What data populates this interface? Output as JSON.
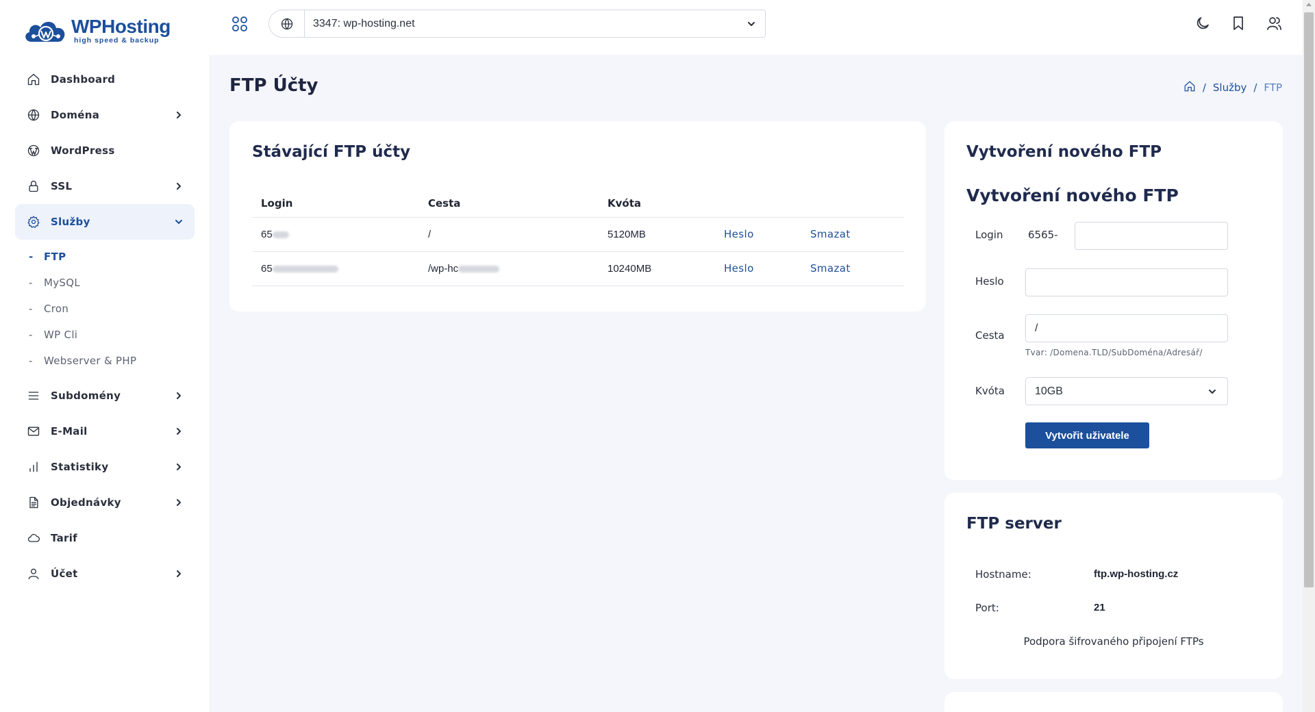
{
  "brand": {
    "name": "WPHosting",
    "tagline": "high speed & backup"
  },
  "header": {
    "domain_value": "3347: wp-hosting.net"
  },
  "sidebar": {
    "items": [
      {
        "label": "Dashboard",
        "icon": "home-icon",
        "has_chevron": false
      },
      {
        "label": "Doména",
        "icon": "globe-icon",
        "has_chevron": true
      },
      {
        "label": "WordPress",
        "icon": "wordpress-icon",
        "has_chevron": false
      },
      {
        "label": "SSL",
        "icon": "lock-icon",
        "has_chevron": true
      },
      {
        "label": "Služby",
        "icon": "gear-icon",
        "has_chevron": true,
        "expanded": true
      }
    ],
    "sub_items": [
      {
        "label": "FTP",
        "active": true
      },
      {
        "label": "MySQL"
      },
      {
        "label": "Cron"
      },
      {
        "label": "WP Cli"
      },
      {
        "label": "Webserver & PHP"
      }
    ],
    "items_after": [
      {
        "label": "Subdomény",
        "icon": "list-icon",
        "has_chevron": true
      },
      {
        "label": "E-Mail",
        "icon": "mail-icon",
        "has_chevron": true
      },
      {
        "label": "Statistiky",
        "icon": "bar-chart-icon",
        "has_chevron": true
      },
      {
        "label": "Objednávky",
        "icon": "document-icon",
        "has_chevron": true
      },
      {
        "label": "Tarif",
        "icon": "cloud-icon",
        "has_chevron": false
      },
      {
        "label": "Účet",
        "icon": "user-icon",
        "has_chevron": true
      }
    ]
  },
  "page": {
    "title": "FTP Účty",
    "breadcrumb": {
      "sep": "/",
      "parent": "Služby",
      "current": "FTP"
    }
  },
  "ftp_accounts": {
    "title": "Stávající FTP účty",
    "columns": [
      "Login",
      "Cesta",
      "Kvóta"
    ],
    "rows": [
      {
        "login": "65",
        "path": "/",
        "quota": "5120MB",
        "action_password": "Heslo",
        "action_delete": "Smazat"
      },
      {
        "login": "65",
        "path": "/wp-hc",
        "quota": "10240MB",
        "action_password": "Heslo",
        "action_delete": "Smazat"
      }
    ]
  },
  "new_ftp": {
    "card_title": "Vytvoření nového FTP",
    "form_title": "Vytvoření nového FTP",
    "login_label": "Login",
    "login_prefix": "6565-",
    "login_value": "",
    "password_label": "Heslo",
    "password_value": "",
    "path_label": "Cesta",
    "path_value": "/",
    "path_hint": "Tvar: /Domena.TLD/SubDoména/Adresář/",
    "quota_label": "Kvóta",
    "quota_value": "10GB",
    "submit_label": "Vytvořit uživatele"
  },
  "ftp_server": {
    "title": "FTP server",
    "hostname_label": "Hostname:",
    "hostname_value": "ftp.wp-hosting.cz",
    "port_label": "Port:",
    "port_value": "21",
    "note": "Podpora šifrovaného připojení FTPs"
  },
  "colors": {
    "accent": "#1c4f9c",
    "background": "#f4f6fb"
  }
}
